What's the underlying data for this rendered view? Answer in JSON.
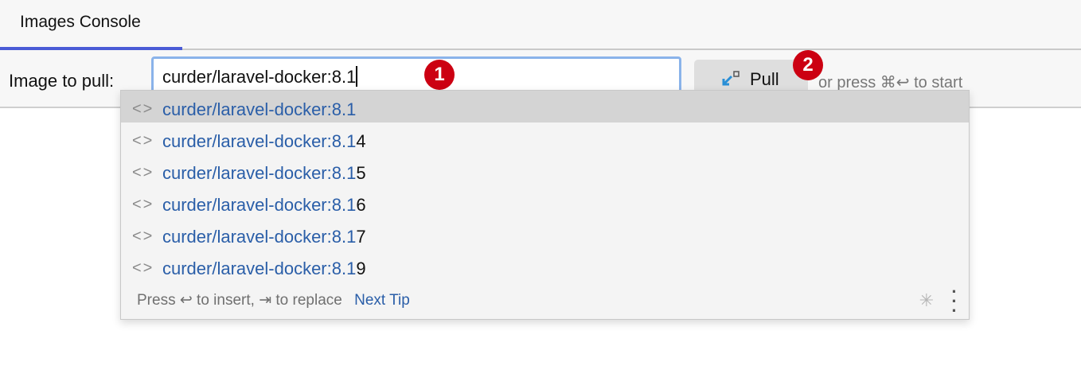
{
  "tabs": [
    {
      "label": "Images Console",
      "active": true
    }
  ],
  "toolbar": {
    "label": "Image to pull:",
    "input_value": "curder/laravel-docker:8.1",
    "badge1": "1",
    "pull_label": "Pull",
    "badge2": "2",
    "hint": "or press ⌘↩ to start"
  },
  "popup": {
    "items": [
      {
        "match": "curder/laravel-docker:8.1",
        "rest": "",
        "selected": true
      },
      {
        "match": "curder/laravel-docker:8.1",
        "rest": "4"
      },
      {
        "match": "curder/laravel-docker:8.1",
        "rest": "5"
      },
      {
        "match": "curder/laravel-docker:8.1",
        "rest": "6"
      },
      {
        "match": "curder/laravel-docker:8.1",
        "rest": "7"
      },
      {
        "match": "curder/laravel-docker:8.1",
        "rest": "9"
      }
    ],
    "footer_text": "Press ↩ to insert, ⇥ to replace",
    "next_tip": "Next Tip"
  },
  "colors": {
    "accent": "#4a5bd6",
    "badge": "#cc0012",
    "link": "#2a5ea8"
  }
}
